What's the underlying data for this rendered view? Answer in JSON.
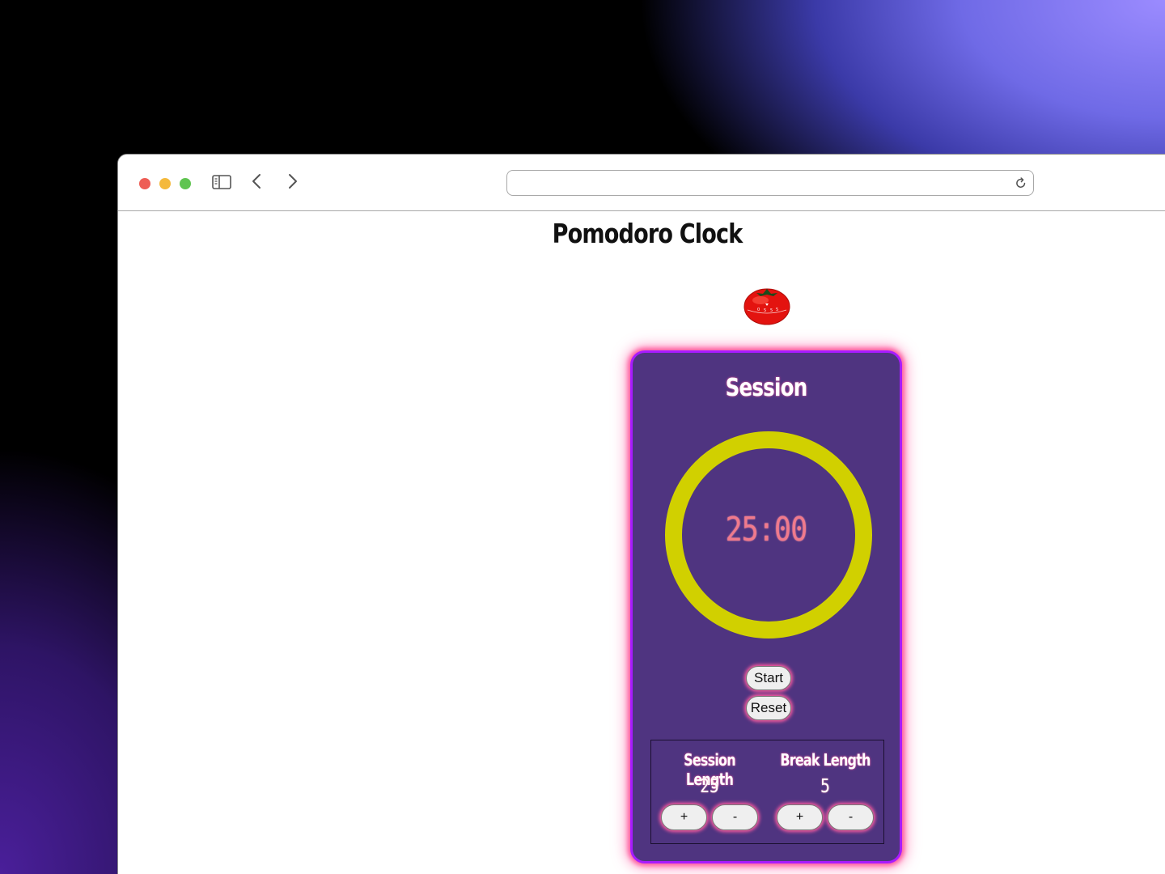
{
  "browser": {
    "address_value": ""
  },
  "app": {
    "title": "Pomodoro Clock"
  },
  "timer_card": {
    "mode_label": "Session",
    "time_display": "25:00",
    "start_label": "Start",
    "reset_label": "Reset"
  },
  "settings": {
    "session": {
      "label": "Session Length",
      "value": "25",
      "plus_label": "+",
      "minus_label": "-"
    },
    "break": {
      "label": "Break Length",
      "value": "5",
      "plus_label": "+",
      "minus_label": "-"
    }
  },
  "icons": {
    "sidebar": "sidebar-icon",
    "back": "chevron-left-icon",
    "forward": "chevron-right-icon",
    "reload": "reload-icon",
    "logo": "tomato-timer-icon"
  },
  "colors": {
    "card_bg": "#4f3480",
    "card_border": "#a81bff",
    "glow": "#ff5ca0",
    "ring": "#d1d000",
    "timer_text": "#f07a8c"
  }
}
